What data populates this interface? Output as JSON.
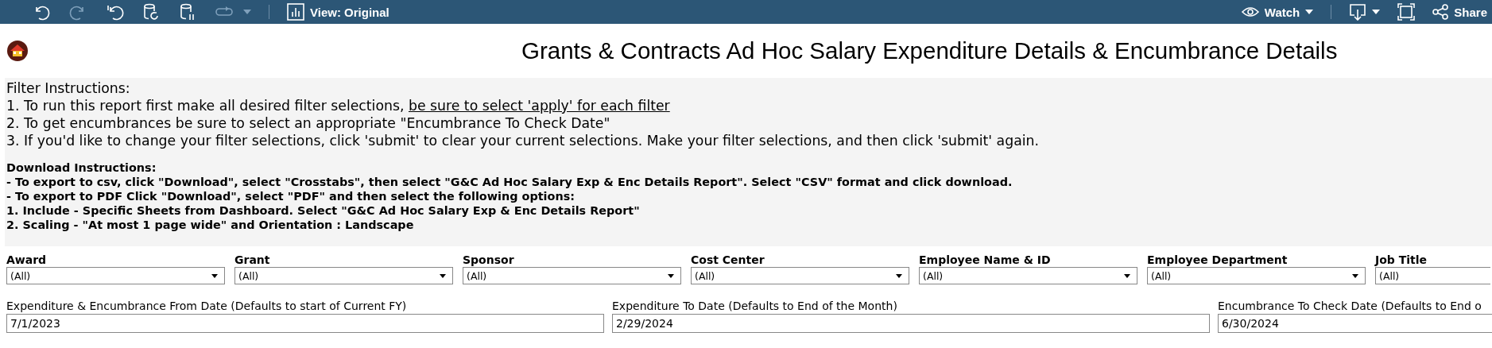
{
  "toolbar": {
    "left": [
      {
        "kind": "undo",
        "disabled": false
      },
      {
        "kind": "redo",
        "disabled": true
      },
      {
        "kind": "revert",
        "disabled": false
      },
      {
        "kind": "refresh",
        "disabled": false
      },
      {
        "kind": "pause",
        "disabled": false
      },
      {
        "kind": "replay",
        "disabled": true
      }
    ],
    "view_label": "View: Original",
    "watch_label": "Watch",
    "share_label": "Share"
  },
  "title": "Grants & Contracts Ad Hoc Salary Expenditure Details & Encumbrance Details",
  "filter_instructions": [
    {
      "text": "Filter Instructions:"
    },
    {
      "text": "1. To run this report first make all desired filter selections, ",
      "link": "be sure to select 'apply' for each filter"
    },
    {
      "text": "2. To get encumbrances be sure to select an appropriate \"Encumbrance To Check Date\""
    },
    {
      "text": "3. If you'd like to change your filter selections, click 'submit' to clear your current selections. Make your filter selections, and then click 'submit' again."
    }
  ],
  "download_instructions": [
    "Download Instructions:",
    "- To export to csv, click \"Download\",  select \"Crosstabs\", then select \"G&C Ad Hoc Salary Exp & Enc Details Report\". Select \"CSV\" format and click download.",
    "- To export to PDF Click \"Download\", select \"PDF\" and then select the following options:",
    "1. Include - Specific Sheets from Dashboard. Select \"G&C Ad Hoc Salary Exp & Enc Details Report\"",
    "2. Scaling - \"At most 1 page wide\" and Orientation : Landscape"
  ],
  "filters": [
    {
      "label": "Award",
      "value": "(All)",
      "cut": false
    },
    {
      "label": "Grant",
      "value": "(All)",
      "cut": false
    },
    {
      "label": "Sponsor",
      "value": "(All)",
      "cut": false
    },
    {
      "label": "Cost Center",
      "value": "(All)",
      "cut": false
    },
    {
      "label": "Employee Name & ID",
      "value": "(All)",
      "cut": false
    },
    {
      "label": "Employee Department",
      "value": "(All)",
      "cut": false
    },
    {
      "label": "Job Title",
      "value": "(All)",
      "cut": true
    }
  ],
  "dates": [
    {
      "label": "Expenditure & Encumbrance From Date (Defaults to start of Current FY)",
      "value": "7/1/2023",
      "cut": false
    },
    {
      "label": "Expenditure To Date (Defaults to End of the Month)",
      "value": "2/29/2024",
      "cut": false
    },
    {
      "label": "Encumbrance To Check Date (Defaults to End o",
      "value": "6/30/2024",
      "cut": true
    }
  ]
}
